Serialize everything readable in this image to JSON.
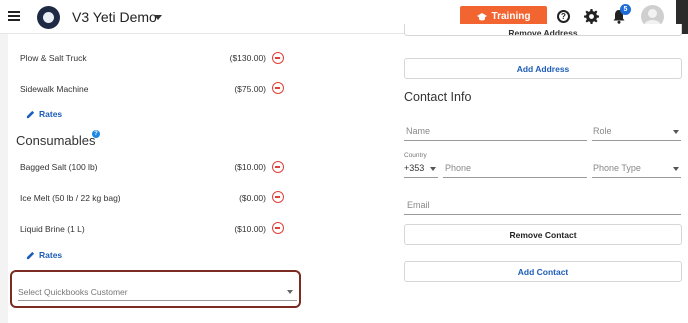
{
  "header": {
    "app_title": "V3 Yeti Demo",
    "training_label": "Training",
    "notification_count": "5",
    "icons": [
      "hamburger-icon",
      "logo",
      "caret-down-icon",
      "graduation-cap-icon",
      "help-icon",
      "gear-icon",
      "bell-icon",
      "avatar"
    ],
    "training_color": "#f26430"
  },
  "equipment": {
    "items": [
      {
        "name": "Plow & Salt Truck",
        "price": "($130.00)"
      },
      {
        "name": "Sidewalk Machine",
        "price": "($75.00)"
      }
    ],
    "rates_label": "Rates"
  },
  "consumables": {
    "title": "Consumables",
    "info_badge": "?",
    "items": [
      {
        "name": "Bagged Salt (100 lb)",
        "price": "($10.00)"
      },
      {
        "name": "Ice Melt (50 lb / 22 kg bag)",
        "price": "($0.00)"
      },
      {
        "name": "Liquid Brine (1 L)",
        "price": "($10.00)"
      }
    ],
    "rates_label": "Rates"
  },
  "quickbooks": {
    "placeholder": "Select Quickbooks Customer"
  },
  "right": {
    "top_button_partial": "Remove Address",
    "add_address_label": "Add Address",
    "contact_info_title": "Contact Info",
    "name_placeholder": "Name",
    "role_placeholder": "Role",
    "country_label": "Country",
    "country_code": "+353",
    "phone_placeholder": "Phone",
    "phone_type_placeholder": "Phone Type",
    "email_placeholder": "Email",
    "remove_contact_label": "Remove Contact",
    "add_contact_label": "Add Contact"
  },
  "colors": {
    "link_blue": "#1d5db8",
    "remove_red": "#e0403a",
    "highlight_border": "#7a2c22"
  }
}
